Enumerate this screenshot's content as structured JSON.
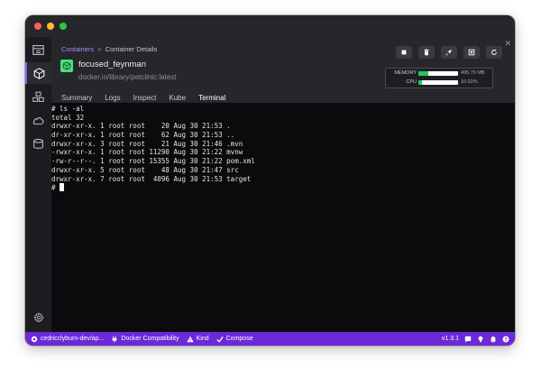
{
  "breadcrumb": {
    "parent": "Containers",
    "separator": ">",
    "current": "Container Details"
  },
  "container": {
    "name": "focused_feynman",
    "image": "docker.io/library/petclinic:latest"
  },
  "stats": {
    "memory": {
      "label": "MEMORY",
      "value": "495.79 MB",
      "fraction": 0.24
    },
    "cpu": {
      "label": "CPU",
      "value": "10.02%",
      "fraction": 0.1
    }
  },
  "actions": [
    {
      "name": "stop-button",
      "icon": "stop-icon"
    },
    {
      "name": "delete-button",
      "icon": "trash-icon"
    },
    {
      "name": "deploy-button",
      "icon": "rocket-icon"
    },
    {
      "name": "open-browser-button",
      "icon": "external-icon"
    },
    {
      "name": "restart-button",
      "icon": "refresh-icon"
    }
  ],
  "tabs": [
    {
      "label": "Summary",
      "active": false
    },
    {
      "label": "Logs",
      "active": false
    },
    {
      "label": "Inspect",
      "active": false
    },
    {
      "label": "Kube",
      "active": false
    },
    {
      "label": "Terminal",
      "active": true
    }
  ],
  "terminal": {
    "lines": [
      "# ls -al",
      "total 32",
      "drwxr-xr-x. 1 root root    20 Aug 30 21:53 .",
      "dr-xr-xr-x. 1 root root    62 Aug 30 21:53 ..",
      "drwxr-xr-x. 3 root root    21 Aug 30 21:46 .mvn",
      "-rwxr-xr-x. 1 root root 11290 Aug 30 21:22 mvnw",
      "-rw-r--r--. 1 root root 15355 Aug 30 21:22 pom.xml",
      "drwxr-xr-x. 5 root root    48 Aug 30 21:47 src",
      "drwxr-xr-x. 7 root root  4096 Aug 30 21:53 target"
    ],
    "prompt": "# "
  },
  "statusbar": {
    "left": [
      {
        "label": "cedricclyburn-dev/ap...",
        "icon": "circle-icon"
      },
      {
        "label": "Docker Compatibility",
        "icon": "plug-icon"
      },
      {
        "label": "Kind",
        "icon": "warning-icon"
      },
      {
        "label": "Compose",
        "icon": "check-icon"
      }
    ],
    "version": "v1.3.1"
  },
  "colors": {
    "accent": "#8b5cf6",
    "status_bar": "#6d28d9",
    "running": "#4ade80"
  }
}
